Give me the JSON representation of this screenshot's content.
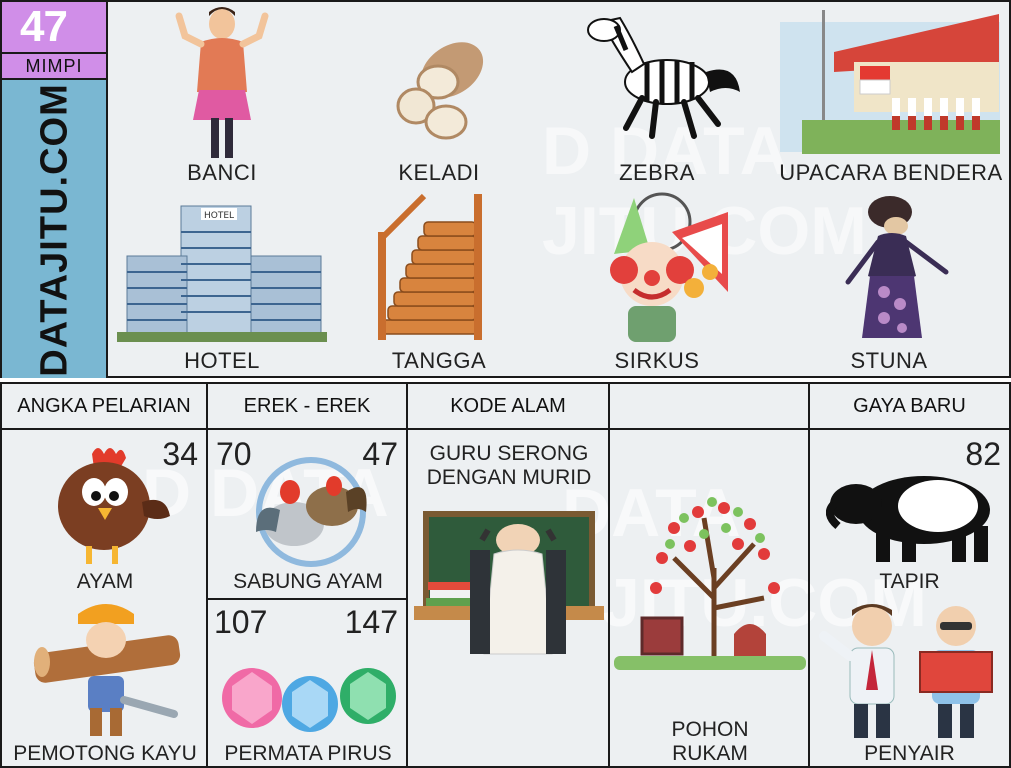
{
  "badge": {
    "number": "47",
    "label": "MIMPI"
  },
  "site": {
    "name": "DATAJITU.COM"
  },
  "top_items": [
    {
      "label": "BANCI"
    },
    {
      "label": "KELADI"
    },
    {
      "label": "ZEBRA"
    },
    {
      "label": "UPACARA BENDERA"
    },
    {
      "label": "HOTEL"
    },
    {
      "label": "TANGGA"
    },
    {
      "label": "SIRKUS"
    },
    {
      "label": "STUNA"
    }
  ],
  "sections": {
    "angka_pelarian": {
      "header": "ANGKA PELARIAN",
      "items": [
        {
          "number": "34",
          "label": "AYAM"
        },
        {
          "label": "PEMOTONG KAYU"
        }
      ]
    },
    "erek_erek": {
      "header": "EREK - EREK",
      "items": [
        {
          "left_number": "70",
          "right_number": "47",
          "label": "SABUNG AYAM"
        },
        {
          "left_number": "107",
          "right_number": "147",
          "label": "PERMATA PIRUS"
        }
      ]
    },
    "kode_alam": {
      "header": "KODE ALAM",
      "item": {
        "line1": "GURU SERONG",
        "line2": "DENGAN MURID"
      }
    },
    "pohon": {
      "header": "",
      "item": {
        "line1": "POHON",
        "line2": "RUKAM"
      }
    },
    "gaya_baru": {
      "header": "GAYA BARU",
      "items": [
        {
          "number": "82",
          "label": "TAPIR"
        },
        {
          "label": "PENYAIR"
        }
      ]
    }
  },
  "colors": {
    "badge": "#d08ee8",
    "site_band": "#7ab7d2",
    "background": "#edf0f2",
    "border": "#1a1a1a"
  }
}
